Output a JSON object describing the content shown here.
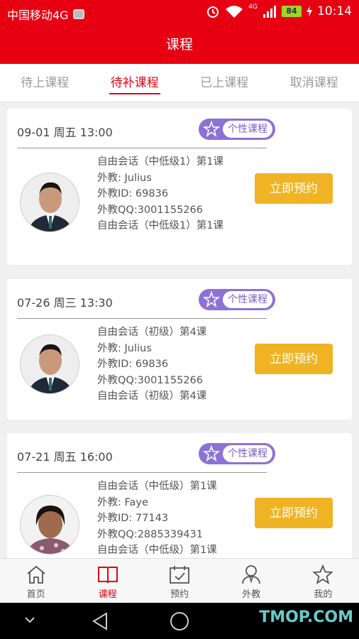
{
  "status_bar": {
    "carrier": "中国移动4G",
    "network": "4G",
    "battery": "84",
    "time": "10:14"
  },
  "header": {
    "title": "课程"
  },
  "tabs": [
    {
      "label": "待上课程",
      "active": false
    },
    {
      "label": "待补课程",
      "active": true
    },
    {
      "label": "已上课程",
      "active": false
    },
    {
      "label": "取消课程",
      "active": false
    }
  ],
  "courses": [
    {
      "date": "09-01  周五  13:00",
      "tag": "个性课程",
      "lines": [
        "自由会话（中低级1）第1课",
        "外教: Julius",
        "外教ID: 69836",
        "外教QQ:3001155266",
        "自由会话（中低级1）第1课"
      ],
      "button": "立即预约"
    },
    {
      "date": "07-26  周三  13:30",
      "tag": "个性课程",
      "lines": [
        "自由会话（初级）第4课",
        "外教: Julius",
        "外教ID: 69836",
        "外教QQ:3001155266",
        "自由会话（初级）第4课"
      ],
      "button": "立即预约"
    },
    {
      "date": "07-21  周五  16:00",
      "tag": "个性课程",
      "lines": [
        "自由会话（中低级）第1课",
        "外教: Faye",
        "外教ID: 77143",
        "外教QQ:2885339431",
        "自由会话（中低级）第1课"
      ],
      "button": "立即预约"
    }
  ],
  "bottom_nav": [
    {
      "label": "首页",
      "icon": "home-icon",
      "active": false
    },
    {
      "label": "课程",
      "icon": "book-icon",
      "active": true
    },
    {
      "label": "预约",
      "icon": "calendar-check-icon",
      "active": false
    },
    {
      "label": "外教",
      "icon": "teacher-icon",
      "active": false
    },
    {
      "label": "我的",
      "icon": "star-icon",
      "active": false
    }
  ],
  "watermark": "TMOP.COM",
  "colors": {
    "brand_red": "#e60012",
    "button_yellow": "#f0b323",
    "tag_purple": "#8b72d6"
  }
}
